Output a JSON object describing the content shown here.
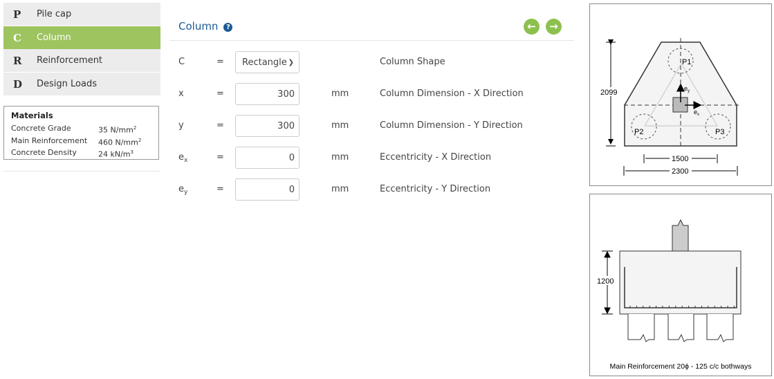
{
  "sidebar": {
    "items": [
      {
        "letter": "P",
        "label": "Pile cap",
        "active": false
      },
      {
        "letter": "C",
        "label": "Column",
        "active": true
      },
      {
        "letter": "R",
        "label": "Reinforcement",
        "active": false
      },
      {
        "letter": "D",
        "label": "Design Loads",
        "active": false
      }
    ],
    "materials": {
      "title": "Materials",
      "rows": [
        {
          "label": "Concrete Grade",
          "value": "35 N/mm",
          "sup": "2"
        },
        {
          "label": "Main Reinforcement",
          "value": "460 N/mm",
          "sup": "2"
        },
        {
          "label": "Concrete Density",
          "value": "24 kN/m",
          "sup": "3"
        }
      ]
    }
  },
  "main": {
    "title": "Column",
    "help_icon": "question-circle-icon",
    "nav_icons": [
      "arrow-left-circle-icon",
      "arrow-right-circle-icon"
    ],
    "accent": "#8dc04e",
    "title_color": "#1d5a96",
    "rows": [
      {
        "symbol": "C",
        "sub": "",
        "eq": "=",
        "value": "Rectangle",
        "unit": "",
        "desc": "Column Shape"
      },
      {
        "symbol": "x",
        "sub": "",
        "eq": "=",
        "value": "300",
        "unit": "mm",
        "desc": "Column Dimension - X Direction"
      },
      {
        "symbol": "y",
        "sub": "",
        "eq": "=",
        "value": "300",
        "unit": "mm",
        "desc": "Column Dimension - Y Direction"
      },
      {
        "symbol": "e",
        "sub": "x",
        "eq": "=",
        "value": "0",
        "unit": "mm",
        "desc": "Eccentricity - X Direction"
      },
      {
        "symbol": "e",
        "sub": "y",
        "eq": "=",
        "value": "0",
        "unit": "mm",
        "desc": "Eccentricity - Y Direction"
      }
    ]
  },
  "plan": {
    "height": "2099",
    "spacing": "1500",
    "width": "2300",
    "piles": [
      "P1",
      "P2",
      "P3"
    ],
    "ex": "e",
    "ex_sub": "x",
    "ey": "e",
    "ey_sub": "y"
  },
  "section": {
    "depth": "1200",
    "caption": "Main Reinforcement 20ϕ - 125 c/c bothways"
  }
}
